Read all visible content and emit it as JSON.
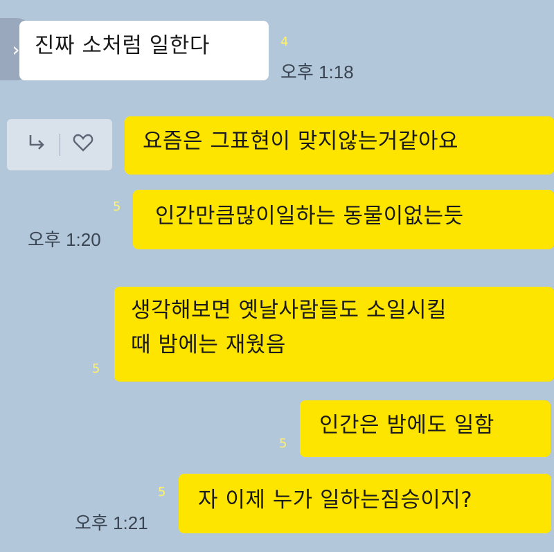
{
  "nav": {
    "icon": "chevron-right-icon"
  },
  "messages": [
    {
      "side": "in",
      "text": "진짜 소처럼 일한다",
      "unread": "4",
      "time": "오후 1:18"
    },
    {
      "side": "out",
      "text": "요즘은 그표현이 맞지않는거같아요"
    },
    {
      "side": "out",
      "text": "인간만큼많이일하는 동물이없는듯",
      "unread": "5",
      "time": "오후 1:20"
    },
    {
      "side": "out",
      "line1": "생각해보면 옛날사람들도 소일시킬",
      "line2": "때 밤에는 재웠음",
      "unread": "5"
    },
    {
      "side": "out",
      "text": "인간은 밤에도 일함",
      "unread": "5"
    },
    {
      "side": "out",
      "text": "자 이제 누가 일하는짐승이지?",
      "unread": "5",
      "time": "오후 1:21"
    }
  ],
  "reaction": {
    "reply_icon": "reply-arrow-icon",
    "like_icon": "heart-icon"
  },
  "colors": {
    "background": "#b2c7da",
    "mine": "#fee500",
    "theirs": "#ffffff",
    "unread": "#fff26a"
  }
}
